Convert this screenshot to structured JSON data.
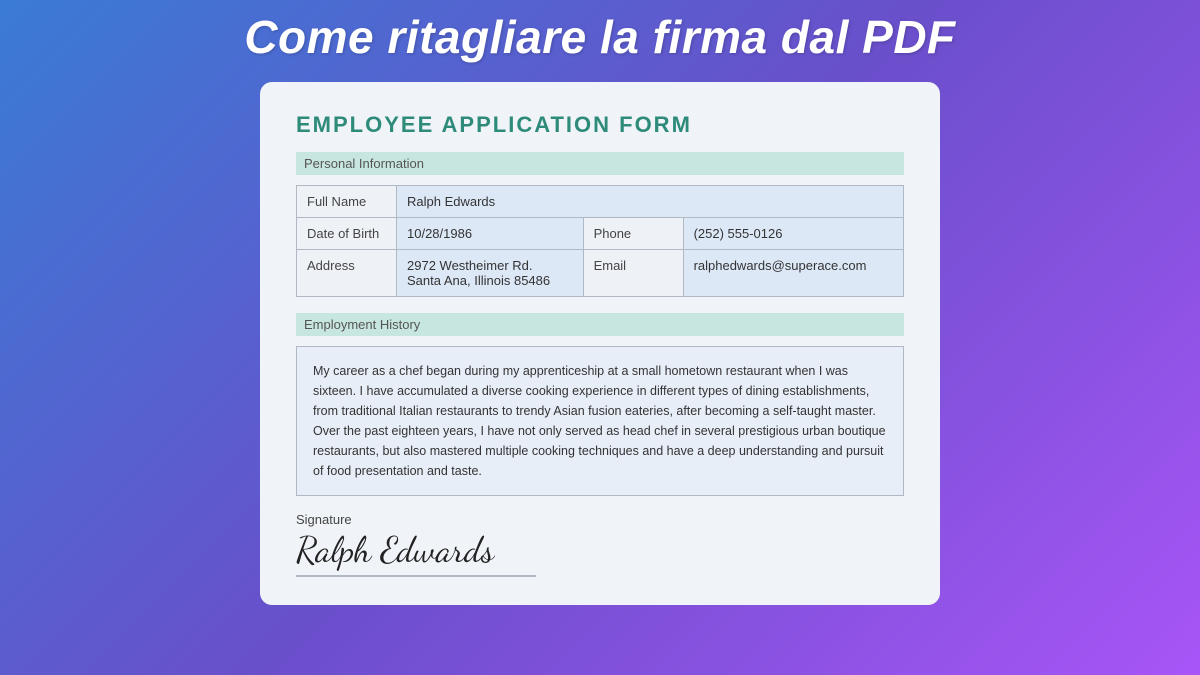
{
  "page": {
    "title": "Come ritagliare la firma dal PDF"
  },
  "form": {
    "title": "EMPLOYEE APPLICATION FORM",
    "sections": {
      "personal_information": {
        "label": "Personal Information",
        "fields": {
          "full_name_label": "Full Name",
          "full_name_value": "Ralph Edwards",
          "dob_label": "Date of Birth",
          "dob_value": "10/28/1986",
          "phone_label": "Phone",
          "phone_value": "(252) 555-0126",
          "address_label": "Address",
          "address_value": "2972 Westheimer Rd.\nSanta Ana, Illinois 85486",
          "email_label": "Email",
          "email_value": "ralphedwards@superace.com"
        }
      },
      "employment_history": {
        "label": "Employment History",
        "text": "My career as a chef began during my apprenticeship at a small hometown restaurant when I was sixteen. I have accumulated a diverse cooking experience in different types of dining establishments, from traditional Italian restaurants to trendy Asian fusion eateries, after becoming a self-taught master. Over the past eighteen years, I have not only served as head chef in several prestigious urban boutique restaurants, but also mastered multiple cooking techniques and have a deep understanding and pursuit of food presentation and taste."
      },
      "signature": {
        "label": "Signature",
        "value": "Ralph Edwards"
      }
    }
  }
}
